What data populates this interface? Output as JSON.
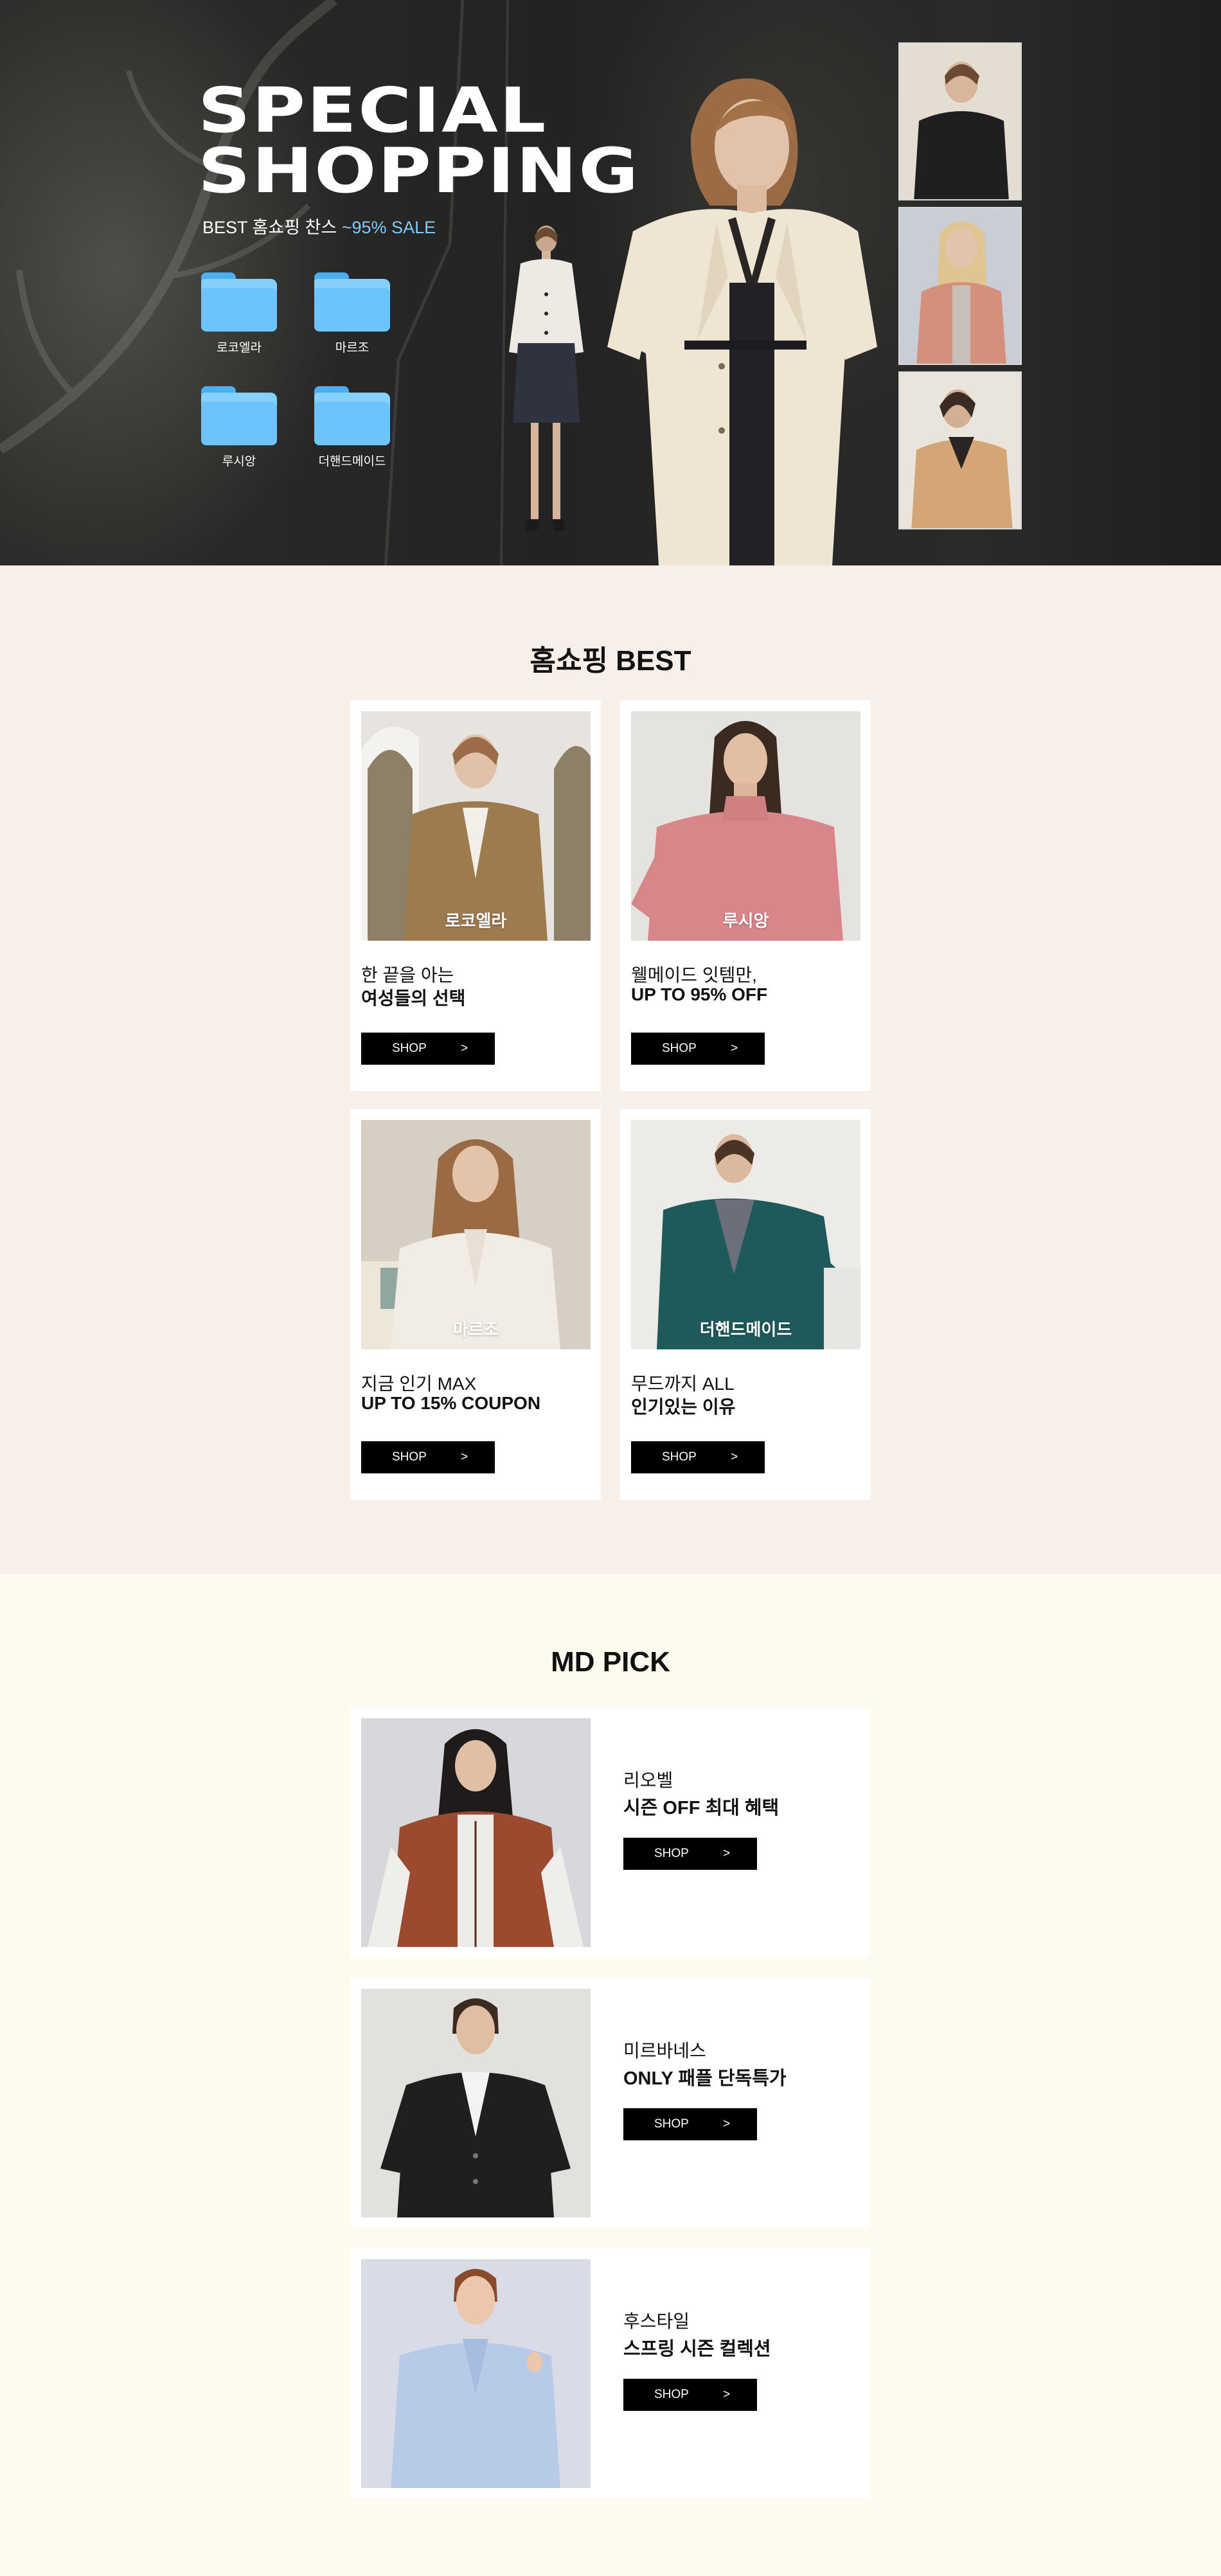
{
  "hero": {
    "title_line1": "SPECIAL",
    "title_line2": "SHOPPING",
    "subtitle_prefix": "BEST 홈쇼핑 찬스 ",
    "subtitle_sale": "~95% SALE",
    "sale_color": "#7ecbff",
    "folders": [
      {
        "label": "로코엘라",
        "icon": "folder-icon"
      },
      {
        "label": "마르조",
        "icon": "folder-icon"
      },
      {
        "label": "루시앙",
        "icon": "folder-icon"
      },
      {
        "label": "더핸드메이드",
        "icon": "folder-icon"
      }
    ]
  },
  "best": {
    "title": "홈쇼핑 BEST",
    "cards": [
      {
        "brand": "로코엘라",
        "line1": "한 끝을 아는",
        "line2": "여성들의 선택",
        "button": "SHOP",
        "arrow": ">"
      },
      {
        "brand": "루시앙",
        "line1": "웰메이드 잇템만,",
        "line2": "UP TO 95% OFF",
        "button": "SHOP",
        "arrow": ">"
      },
      {
        "brand": "마르조",
        "line1": "지금 인기 MAX",
        "line2": "UP TO 15% COUPON",
        "button": "SHOP",
        "arrow": ">"
      },
      {
        "brand": "더핸드메이드",
        "line1": "무드까지 ALL",
        "line2": "인기있는 이유",
        "button": "SHOP",
        "arrow": ">"
      }
    ]
  },
  "md_pick": {
    "title": "MD PICK",
    "items": [
      {
        "brand": "리오벨",
        "headline": "시즌 OFF 최대 혜택",
        "button": "SHOP",
        "arrow": ">"
      },
      {
        "brand": "미르바네스",
        "headline": "ONLY 패플 단독특가",
        "button": "SHOP",
        "arrow": ">"
      },
      {
        "brand": "후스타일",
        "headline": "스프링 시즌 컬렉션",
        "button": "SHOP",
        "arrow": ">"
      }
    ]
  },
  "colors": {
    "hero_bg": "#262626",
    "best_bg": "#f8f0e8",
    "md_bg": "#fdfaee",
    "button_bg": "#000000",
    "folder_blue": "#6cc4fb"
  }
}
